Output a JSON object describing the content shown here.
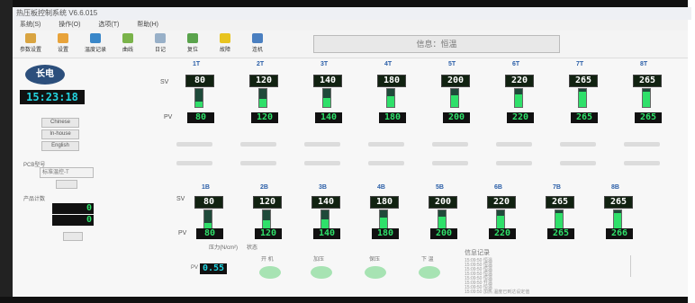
{
  "title": "热压板控制系统 V6.6.015",
  "menu": [
    "系统(S)",
    "操作(O)",
    "选项(T)",
    "帮助(H)"
  ],
  "toolbar": [
    {
      "label": "参数设置",
      "icon": "document-icon",
      "color": "#d9a441"
    },
    {
      "label": "设置",
      "icon": "settings-icon",
      "color": "#e8a33b"
    },
    {
      "label": "温度记录",
      "icon": "chart-icon",
      "color": "#3a87c9"
    },
    {
      "label": "曲线",
      "icon": "curve-icon",
      "color": "#7ab34a"
    },
    {
      "label": "日记",
      "icon": "log-icon",
      "color": "#98b0c8"
    },
    {
      "label": "复位",
      "icon": "reset-icon",
      "color": "#5aa34c"
    },
    {
      "label": "故障",
      "icon": "warning-icon",
      "color": "#e8c420"
    },
    {
      "label": "连机",
      "icon": "link-icon",
      "color": "#4a7fc0"
    }
  ],
  "info": "信息：恒温",
  "logo": "长电",
  "clock": "15:23:18",
  "languages": [
    "Chinese",
    "In-house",
    "English"
  ],
  "pcb": {
    "label": "PCB型号",
    "value": "标准温控-T"
  },
  "counter": {
    "label": "产品计数",
    "values": [
      "0",
      "0"
    ]
  },
  "sv_label": "SV",
  "pv_label": "PV",
  "top_channels": [
    {
      "name": "1T",
      "sv": "80",
      "pv": "80",
      "level": 0.3
    },
    {
      "name": "2T",
      "sv": "120",
      "pv": "120",
      "level": 0.45
    },
    {
      "name": "3T",
      "sv": "140",
      "pv": "140",
      "level": 0.5
    },
    {
      "name": "4T",
      "sv": "180",
      "pv": "180",
      "level": 0.6
    },
    {
      "name": "5T",
      "sv": "200",
      "pv": "200",
      "level": 0.65
    },
    {
      "name": "6T",
      "sv": "220",
      "pv": "220",
      "level": 0.7
    },
    {
      "name": "7T",
      "sv": "265",
      "pv": "265",
      "level": 0.85
    },
    {
      "name": "8T",
      "sv": "265",
      "pv": "265",
      "level": 0.85
    }
  ],
  "bottom_channels": [
    {
      "name": "1B",
      "sv": "80",
      "pv": "80",
      "level": 0.3
    },
    {
      "name": "2B",
      "sv": "120",
      "pv": "120",
      "level": 0.45
    },
    {
      "name": "3B",
      "sv": "140",
      "pv": "140",
      "level": 0.5
    },
    {
      "name": "4B",
      "sv": "180",
      "pv": "180",
      "level": 0.6
    },
    {
      "name": "5B",
      "sv": "200",
      "pv": "200",
      "level": 0.65
    },
    {
      "name": "6B",
      "sv": "220",
      "pv": "220",
      "level": 0.7
    },
    {
      "name": "7B",
      "sv": "265",
      "pv": "265",
      "level": 0.85
    },
    {
      "name": "8B",
      "sv": "265",
      "pv": "266",
      "level": 0.85
    }
  ],
  "pressure": {
    "label": "压力(N/cm²)",
    "value": "0.55"
  },
  "state_label": "状态",
  "lamps": [
    "开 机",
    "加压",
    "保压",
    "下 温"
  ],
  "log": {
    "title": "信息记录",
    "rows": [
      "15:09:50 恒温",
      "15:09:50 恒温",
      "15:09:50 恒温",
      "15:09:50 恒温",
      "15:09:50 恒温",
      "15:09:50 升温",
      "15:09:50 恒温",
      "15:09:50 加热 温度已到达设定值"
    ]
  }
}
